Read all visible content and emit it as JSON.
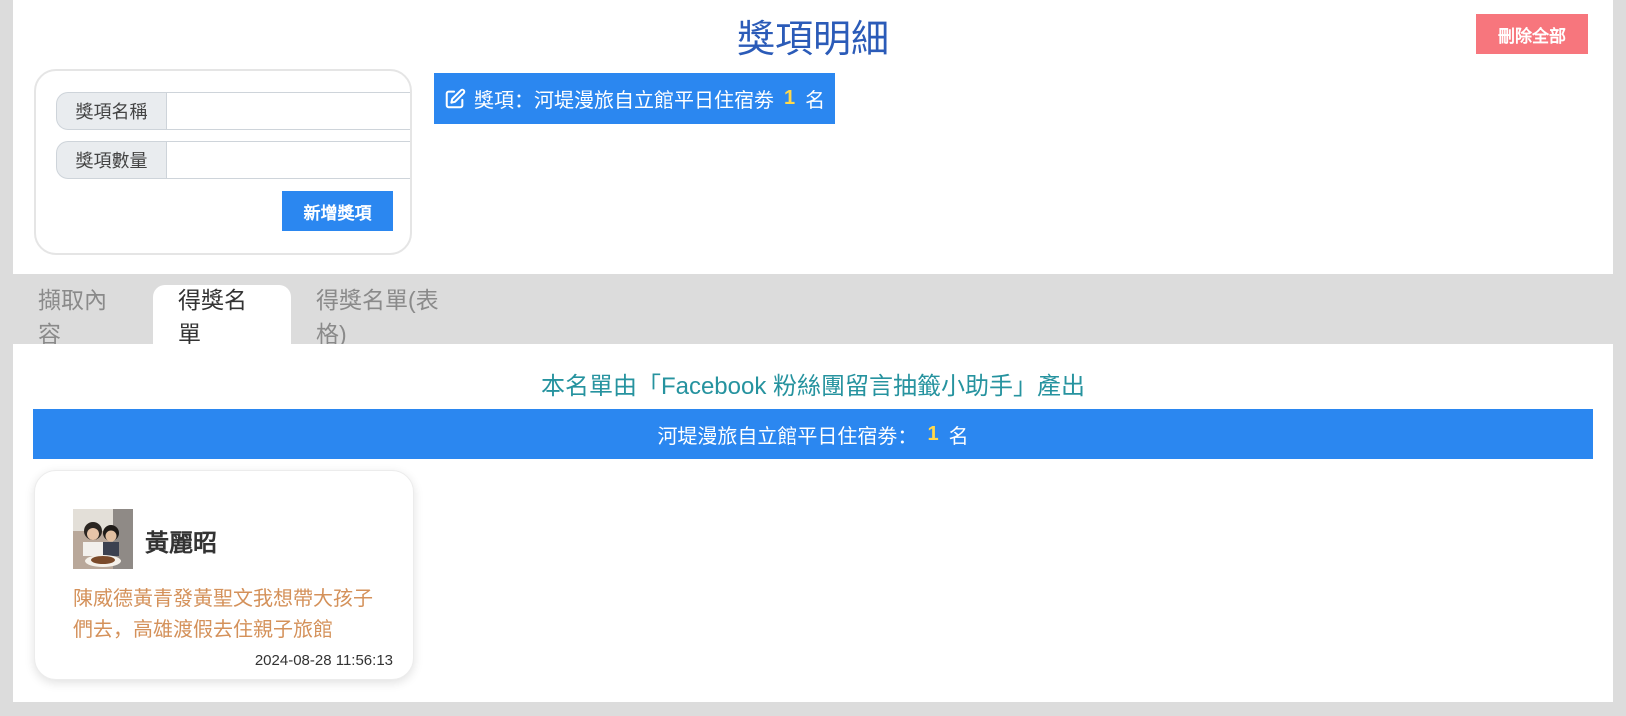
{
  "header": {
    "title": "獎項明細",
    "delete_all_label": "刪除全部"
  },
  "form": {
    "name_label": "獎項名稱",
    "name_value": "",
    "quantity_label": "獎項數量",
    "quantity_value": "",
    "add_button_label": "新增獎項"
  },
  "prizes": [
    {
      "prefix": "獎項：",
      "name": "河堤漫旅自立館平日住宿劵",
      "count": "1",
      "unit": "名"
    }
  ],
  "tabs": [
    {
      "label": "擷取內容",
      "active": false
    },
    {
      "label": "得獎名單",
      "active": true
    },
    {
      "label": "得獎名單(表格)",
      "active": false
    }
  ],
  "result": {
    "credit": "本名單由「Facebook 粉絲團留言抽籤小助手」產出",
    "prize_bar": {
      "name": "河堤漫旅自立館平日住宿劵：",
      "count": "1",
      "unit": "名"
    },
    "winners": [
      {
        "name": "黃麗昭",
        "comment": "陳威德黃青發黃聖文我想帶大孩子們去，高雄渡假去住親子旅館",
        "timestamp": "2024-08-28 11:56:13"
      }
    ]
  },
  "colors": {
    "primary": "#2b87f0",
    "title": "#2b5bb8",
    "delete": "#f7767d",
    "credit": "#26939f",
    "count_highlight": "#ffd84a",
    "comment": "#d4915a"
  },
  "icons": {
    "prize_item": "edit-icon"
  }
}
